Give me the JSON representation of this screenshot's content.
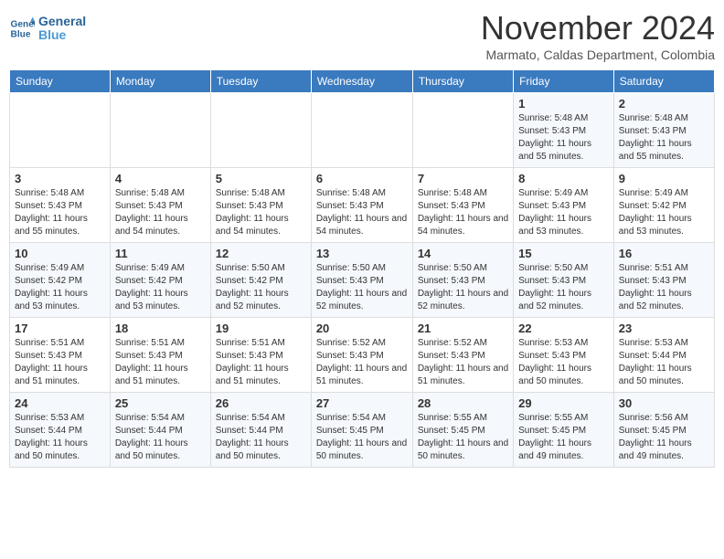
{
  "header": {
    "logo_line1": "General",
    "logo_line2": "Blue",
    "month": "November 2024",
    "location": "Marmato, Caldas Department, Colombia"
  },
  "weekdays": [
    "Sunday",
    "Monday",
    "Tuesday",
    "Wednesday",
    "Thursday",
    "Friday",
    "Saturday"
  ],
  "weeks": [
    [
      {
        "day": "",
        "info": ""
      },
      {
        "day": "",
        "info": ""
      },
      {
        "day": "",
        "info": ""
      },
      {
        "day": "",
        "info": ""
      },
      {
        "day": "",
        "info": ""
      },
      {
        "day": "1",
        "info": "Sunrise: 5:48 AM\nSunset: 5:43 PM\nDaylight: 11 hours and 55 minutes."
      },
      {
        "day": "2",
        "info": "Sunrise: 5:48 AM\nSunset: 5:43 PM\nDaylight: 11 hours and 55 minutes."
      }
    ],
    [
      {
        "day": "3",
        "info": "Sunrise: 5:48 AM\nSunset: 5:43 PM\nDaylight: 11 hours and 55 minutes."
      },
      {
        "day": "4",
        "info": "Sunrise: 5:48 AM\nSunset: 5:43 PM\nDaylight: 11 hours and 54 minutes."
      },
      {
        "day": "5",
        "info": "Sunrise: 5:48 AM\nSunset: 5:43 PM\nDaylight: 11 hours and 54 minutes."
      },
      {
        "day": "6",
        "info": "Sunrise: 5:48 AM\nSunset: 5:43 PM\nDaylight: 11 hours and 54 minutes."
      },
      {
        "day": "7",
        "info": "Sunrise: 5:48 AM\nSunset: 5:43 PM\nDaylight: 11 hours and 54 minutes."
      },
      {
        "day": "8",
        "info": "Sunrise: 5:49 AM\nSunset: 5:43 PM\nDaylight: 11 hours and 53 minutes."
      },
      {
        "day": "9",
        "info": "Sunrise: 5:49 AM\nSunset: 5:42 PM\nDaylight: 11 hours and 53 minutes."
      }
    ],
    [
      {
        "day": "10",
        "info": "Sunrise: 5:49 AM\nSunset: 5:42 PM\nDaylight: 11 hours and 53 minutes."
      },
      {
        "day": "11",
        "info": "Sunrise: 5:49 AM\nSunset: 5:42 PM\nDaylight: 11 hours and 53 minutes."
      },
      {
        "day": "12",
        "info": "Sunrise: 5:50 AM\nSunset: 5:42 PM\nDaylight: 11 hours and 52 minutes."
      },
      {
        "day": "13",
        "info": "Sunrise: 5:50 AM\nSunset: 5:43 PM\nDaylight: 11 hours and 52 minutes."
      },
      {
        "day": "14",
        "info": "Sunrise: 5:50 AM\nSunset: 5:43 PM\nDaylight: 11 hours and 52 minutes."
      },
      {
        "day": "15",
        "info": "Sunrise: 5:50 AM\nSunset: 5:43 PM\nDaylight: 11 hours and 52 minutes."
      },
      {
        "day": "16",
        "info": "Sunrise: 5:51 AM\nSunset: 5:43 PM\nDaylight: 11 hours and 52 minutes."
      }
    ],
    [
      {
        "day": "17",
        "info": "Sunrise: 5:51 AM\nSunset: 5:43 PM\nDaylight: 11 hours and 51 minutes."
      },
      {
        "day": "18",
        "info": "Sunrise: 5:51 AM\nSunset: 5:43 PM\nDaylight: 11 hours and 51 minutes."
      },
      {
        "day": "19",
        "info": "Sunrise: 5:51 AM\nSunset: 5:43 PM\nDaylight: 11 hours and 51 minutes."
      },
      {
        "day": "20",
        "info": "Sunrise: 5:52 AM\nSunset: 5:43 PM\nDaylight: 11 hours and 51 minutes."
      },
      {
        "day": "21",
        "info": "Sunrise: 5:52 AM\nSunset: 5:43 PM\nDaylight: 11 hours and 51 minutes."
      },
      {
        "day": "22",
        "info": "Sunrise: 5:53 AM\nSunset: 5:43 PM\nDaylight: 11 hours and 50 minutes."
      },
      {
        "day": "23",
        "info": "Sunrise: 5:53 AM\nSunset: 5:44 PM\nDaylight: 11 hours and 50 minutes."
      }
    ],
    [
      {
        "day": "24",
        "info": "Sunrise: 5:53 AM\nSunset: 5:44 PM\nDaylight: 11 hours and 50 minutes."
      },
      {
        "day": "25",
        "info": "Sunrise: 5:54 AM\nSunset: 5:44 PM\nDaylight: 11 hours and 50 minutes."
      },
      {
        "day": "26",
        "info": "Sunrise: 5:54 AM\nSunset: 5:44 PM\nDaylight: 11 hours and 50 minutes."
      },
      {
        "day": "27",
        "info": "Sunrise: 5:54 AM\nSunset: 5:45 PM\nDaylight: 11 hours and 50 minutes."
      },
      {
        "day": "28",
        "info": "Sunrise: 5:55 AM\nSunset: 5:45 PM\nDaylight: 11 hours and 50 minutes."
      },
      {
        "day": "29",
        "info": "Sunrise: 5:55 AM\nSunset: 5:45 PM\nDaylight: 11 hours and 49 minutes."
      },
      {
        "day": "30",
        "info": "Sunrise: 5:56 AM\nSunset: 5:45 PM\nDaylight: 11 hours and 49 minutes."
      }
    ]
  ]
}
